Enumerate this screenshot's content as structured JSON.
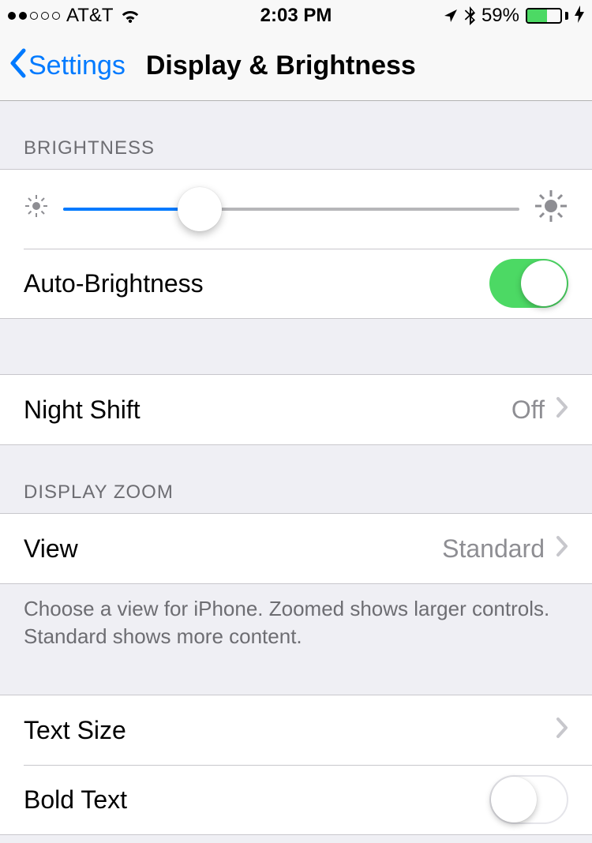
{
  "status": {
    "carrier": "AT&T",
    "time": "2:03 PM",
    "battery_pct": "59%",
    "signal_filled": 2,
    "signal_total": 5
  },
  "nav": {
    "back_label": "Settings",
    "title": "Display & Brightness"
  },
  "brightness": {
    "header": "BRIGHTNESS",
    "slider_pct": 30,
    "auto_label": "Auto-Brightness",
    "auto_on": true
  },
  "night_shift": {
    "label": "Night Shift",
    "value": "Off"
  },
  "display_zoom": {
    "header": "DISPLAY ZOOM",
    "view_label": "View",
    "view_value": "Standard",
    "footer": "Choose a view for iPhone. Zoomed shows larger controls. Standard shows more content."
  },
  "text": {
    "text_size_label": "Text Size",
    "bold_label": "Bold Text",
    "bold_on": false
  }
}
